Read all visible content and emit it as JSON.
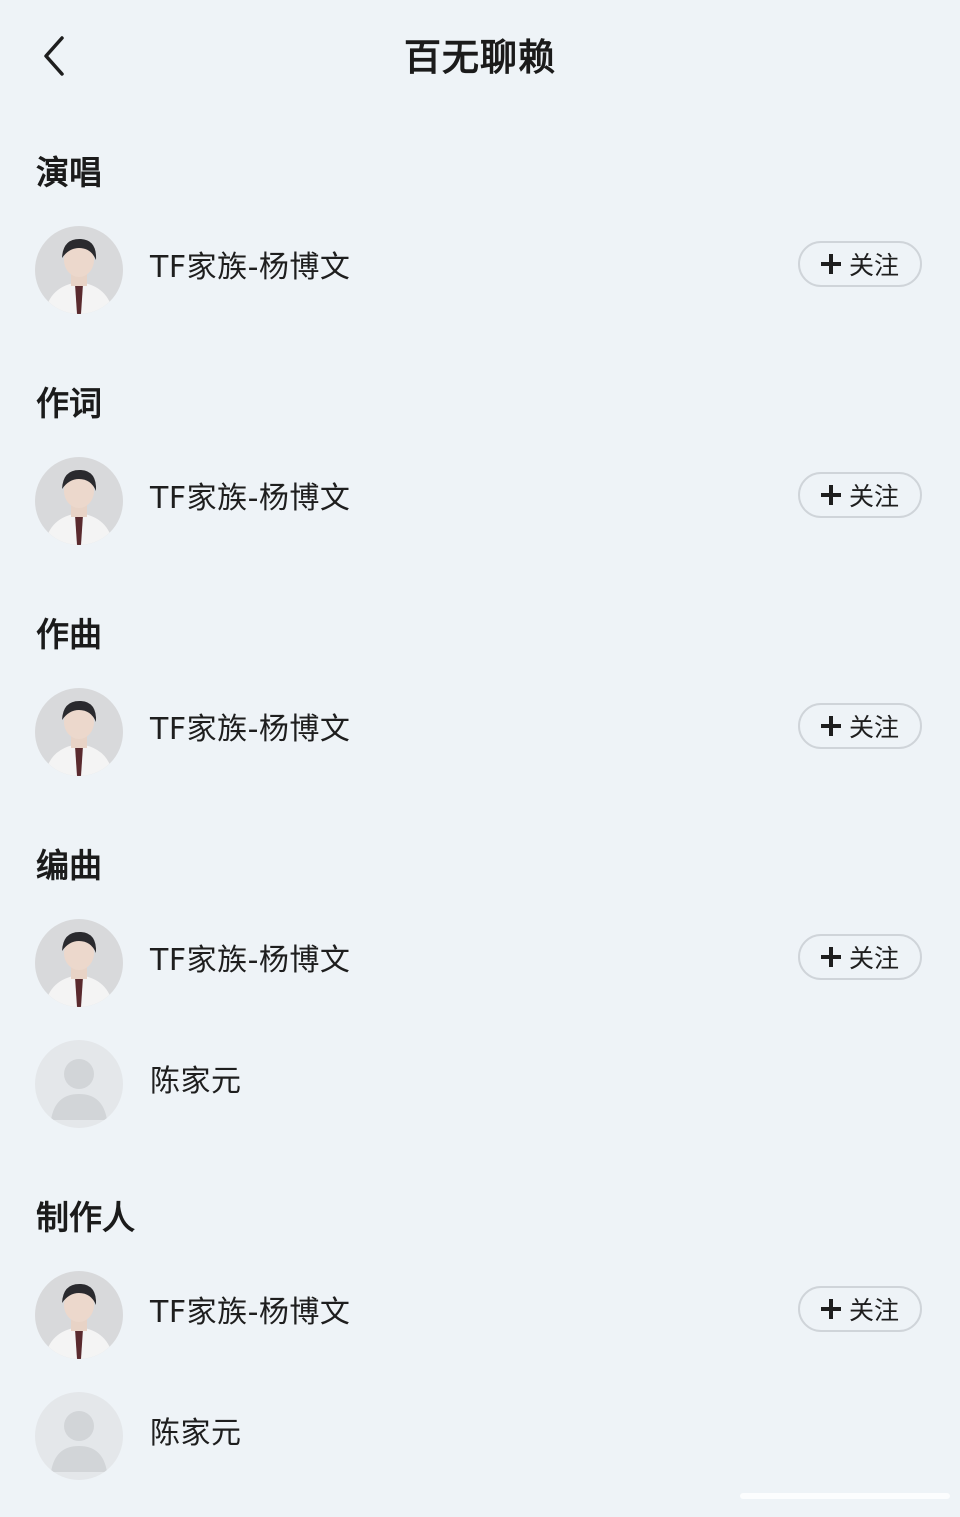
{
  "header": {
    "title": "百无聊赖",
    "back_icon": "chevron-left-icon"
  },
  "sections": [
    {
      "title": "演唱",
      "people": [
        {
          "name": "TF家族-杨博文",
          "avatar": "photo",
          "follow_label": "关注",
          "followable": true
        }
      ]
    },
    {
      "title": "作词",
      "people": [
        {
          "name": "TF家族-杨博文",
          "avatar": "photo",
          "follow_label": "关注",
          "followable": true
        }
      ]
    },
    {
      "title": "作曲",
      "people": [
        {
          "name": "TF家族-杨博文",
          "avatar": "photo",
          "follow_label": "关注",
          "followable": true
        }
      ]
    },
    {
      "title": "编曲",
      "people": [
        {
          "name": "TF家族-杨博文",
          "avatar": "photo",
          "follow_label": "关注",
          "followable": true
        },
        {
          "name": "陈家元",
          "avatar": "placeholder",
          "followable": false
        }
      ]
    },
    {
      "title": "制作人",
      "people": [
        {
          "name": "TF家族-杨博文",
          "avatar": "photo",
          "follow_label": "关注",
          "followable": true
        },
        {
          "name": "陈家元",
          "avatar": "placeholder",
          "followable": false
        }
      ]
    }
  ],
  "colors": {
    "background": "#eef3f7",
    "button_border": "#cfd4d9",
    "text": "#1e1e1e"
  }
}
